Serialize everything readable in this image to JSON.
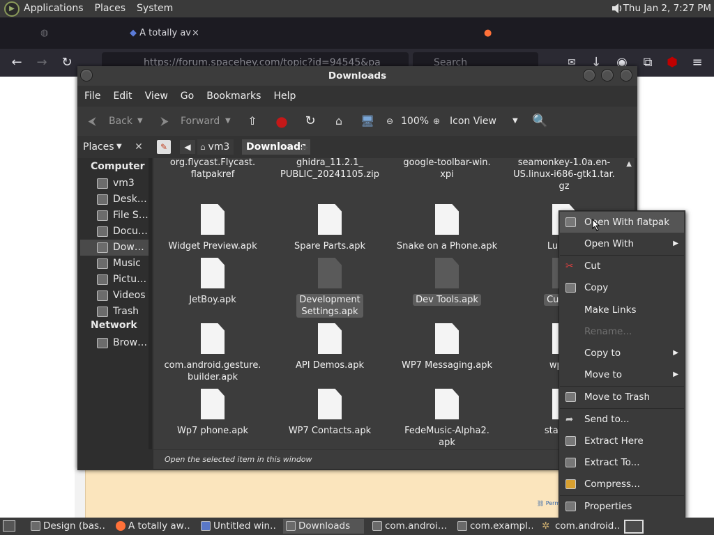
{
  "top_panel": {
    "menus": [
      "Applications",
      "Places",
      "System"
    ],
    "clock": "Thu Jan  2,  7:27 PM"
  },
  "browser": {
    "active_tab": "A totally av",
    "url": "https://forum.spacehey.com/topic?id=94545&pa",
    "search_placeholder": "Search",
    "permalink": "Permali"
  },
  "file_manager": {
    "title": "Downloads",
    "menus": [
      "File",
      "Edit",
      "View",
      "Go",
      "Bookmarks",
      "Help"
    ],
    "toolbar": {
      "back": "Back",
      "forward": "Forward",
      "zoom": "100%",
      "view_mode": "Icon View"
    },
    "places_label": "Places",
    "breadcrumb": {
      "parent": "vm3",
      "current": "Downloads"
    },
    "sidebar": {
      "computer_heading": "Computer",
      "computer_items": [
        "vm3",
        "Desk…",
        "File S…",
        "Docu…",
        "Dow…",
        "Music",
        "Pictu…",
        "Videos",
        "Trash"
      ],
      "network_heading": "Network",
      "network_items": [
        "Brow…"
      ]
    },
    "files": [
      {
        "name": "org.flycast.Flycast.\nflatpakref"
      },
      {
        "name": "ghidra_11.2.1_\nPUBLIC_20241105.zip"
      },
      {
        "name": "google-toolbar-win.\nxpi"
      },
      {
        "name": "seamonkey-1.0a.en-\nUS.linux-i686-gtk1.tar.\ngz"
      },
      {
        "name": "Widget Preview.apk"
      },
      {
        "name": "Spare Parts.apk"
      },
      {
        "name": "Snake on a Phone.apk"
      },
      {
        "name": "Lunar L"
      },
      {
        "name": "JetBoy.apk"
      },
      {
        "name": "Development\nSettings.apk"
      },
      {
        "name": "Dev Tools.apk"
      },
      {
        "name": "Custom"
      },
      {
        "name": "com.android.gesture.\nbuilder.apk"
      },
      {
        "name": "API Demos.apk"
      },
      {
        "name": "WP7 Messaging.apk"
      },
      {
        "name": "wp7ke"
      },
      {
        "name": "Wp7 phone.apk"
      },
      {
        "name": "WP7 Contacts.apk"
      },
      {
        "name": "FedeMusic-Alpha2.\napk"
      },
      {
        "name": "statusba"
      }
    ],
    "status": "Open the selected item in this window"
  },
  "context_menu": {
    "items": [
      "Open With flatpak",
      "Open With",
      "Cut",
      "Copy",
      "Make Links",
      "Rename...",
      "Copy to",
      "Move to",
      "Move to Trash",
      "Send to...",
      "Extract Here",
      "Extract To...",
      "Compress...",
      "Properties"
    ]
  },
  "taskbar": {
    "tasks": [
      "Design (bas…",
      "A totally aw…",
      "Untitled win…",
      "Downloads",
      "com.androi…",
      "com.exampl…",
      "com.android…"
    ]
  }
}
